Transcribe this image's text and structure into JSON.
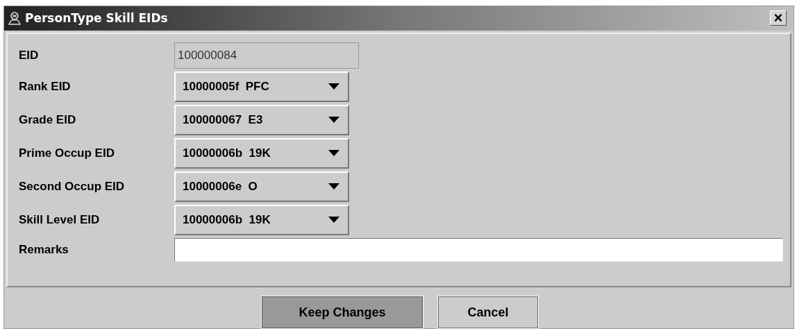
{
  "window": {
    "title": "PersonType Skill EIDs",
    "close": "×"
  },
  "fields": [
    {
      "kind": "text",
      "label": "EID",
      "value": "100000084",
      "disabled": true
    },
    {
      "kind": "combo",
      "label": "Rank EID",
      "value": "10000005f  PFC"
    },
    {
      "kind": "combo",
      "label": "Grade EID",
      "value": "100000067  E3"
    },
    {
      "kind": "combo",
      "label": "Prime Occup EID",
      "value": "10000006b  19K"
    },
    {
      "kind": "combo",
      "label": "Second Occup EID",
      "value": "10000006e  O"
    },
    {
      "kind": "combo",
      "label": "Skill Level EID",
      "value": "10000006b  19K"
    },
    {
      "kind": "wide",
      "label": "Remarks"
    }
  ],
  "buttons": [
    {
      "label": "Keep Changes",
      "pressed": true
    },
    {
      "label": "Cancel",
      "pressed": false
    }
  ]
}
